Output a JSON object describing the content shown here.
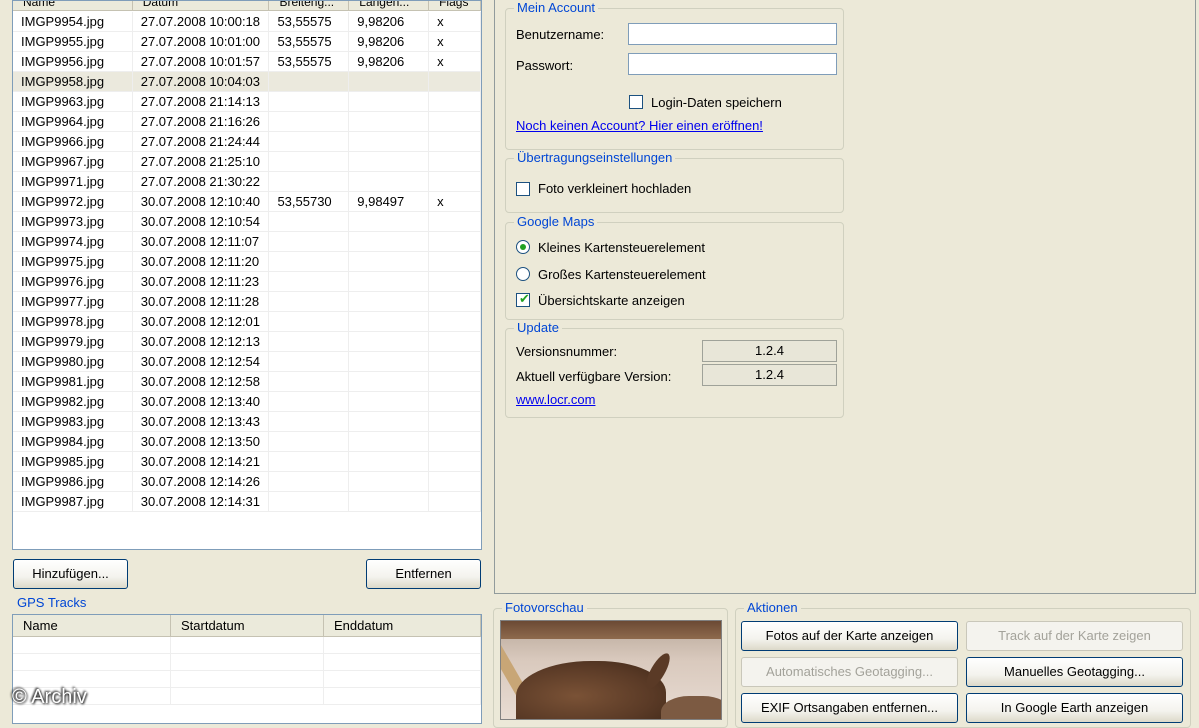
{
  "photo_list": {
    "columns": [
      "Name",
      "Datum",
      "Breiteng...",
      "Längen...",
      "Flags"
    ],
    "rows": [
      [
        "IMGP9954.jpg",
        "27.07.2008 10:00:18",
        "53,55575",
        "9,98206",
        "x"
      ],
      [
        "IMGP9955.jpg",
        "27.07.2008 10:01:00",
        "53,55575",
        "9,98206",
        "x"
      ],
      [
        "IMGP9956.jpg",
        "27.07.2008 10:01:57",
        "53,55575",
        "9,98206",
        "x"
      ],
      [
        "IMGP9958.jpg",
        "27.07.2008 10:04:03",
        "",
        "",
        ""
      ],
      [
        "IMGP9963.jpg",
        "27.07.2008 21:14:13",
        "",
        "",
        ""
      ],
      [
        "IMGP9964.jpg",
        "27.07.2008 21:16:26",
        "",
        "",
        ""
      ],
      [
        "IMGP9966.jpg",
        "27.07.2008 21:24:44",
        "",
        "",
        ""
      ],
      [
        "IMGP9967.jpg",
        "27.07.2008 21:25:10",
        "",
        "",
        ""
      ],
      [
        "IMGP9971.jpg",
        "27.07.2008 21:30:22",
        "",
        "",
        ""
      ],
      [
        "IMGP9972.jpg",
        "30.07.2008 12:10:40",
        "53,55730",
        "9,98497",
        "x"
      ],
      [
        "IMGP9973.jpg",
        "30.07.2008 12:10:54",
        "",
        "",
        ""
      ],
      [
        "IMGP9974.jpg",
        "30.07.2008 12:11:07",
        "",
        "",
        ""
      ],
      [
        "IMGP9975.jpg",
        "30.07.2008 12:11:20",
        "",
        "",
        ""
      ],
      [
        "IMGP9976.jpg",
        "30.07.2008 12:11:23",
        "",
        "",
        ""
      ],
      [
        "IMGP9977.jpg",
        "30.07.2008 12:11:28",
        "",
        "",
        ""
      ],
      [
        "IMGP9978.jpg",
        "30.07.2008 12:12:01",
        "",
        "",
        ""
      ],
      [
        "IMGP9979.jpg",
        "30.07.2008 12:12:13",
        "",
        "",
        ""
      ],
      [
        "IMGP9980.jpg",
        "30.07.2008 12:12:54",
        "",
        "",
        ""
      ],
      [
        "IMGP9981.jpg",
        "30.07.2008 12:12:58",
        "",
        "",
        ""
      ],
      [
        "IMGP9982.jpg",
        "30.07.2008 12:13:40",
        "",
        "",
        ""
      ],
      [
        "IMGP9983.jpg",
        "30.07.2008 12:13:43",
        "",
        "",
        ""
      ],
      [
        "IMGP9984.jpg",
        "30.07.2008 12:13:50",
        "",
        "",
        ""
      ],
      [
        "IMGP9985.jpg",
        "30.07.2008 12:14:21",
        "",
        "",
        ""
      ],
      [
        "IMGP9986.jpg",
        "30.07.2008 12:14:26",
        "",
        "",
        ""
      ],
      [
        "IMGP9987.jpg",
        "30.07.2008 12:14:31",
        "",
        "",
        ""
      ]
    ],
    "selected_row": 3,
    "add_button": "Hinzufügen...",
    "remove_button": "Entfernen"
  },
  "account": {
    "title": "Mein Account",
    "username_label": "Benutzername:",
    "username_value": "",
    "password_label": "Passwort:",
    "password_value": "",
    "save_login_label": "Login-Daten speichern",
    "save_login_checked": false,
    "signup_link": "Noch keinen Account? Hier einen eröffnen!"
  },
  "transfer": {
    "title": "Übertragungseinstellungen",
    "resize_label": "Foto verkleinert hochladen",
    "resize_checked": false
  },
  "google_maps": {
    "title": "Google Maps",
    "small_control_label": "Kleines Kartensteuerelement",
    "large_control_label": "Großes Kartensteuerelement",
    "selected": "small",
    "overview_label": "Übersichtskarte anzeigen",
    "overview_checked": true
  },
  "update": {
    "title": "Update",
    "version_label": "Versionsnummer:",
    "version_value": "1.2.4",
    "available_label": "Aktuell verfügbare Version:",
    "available_value": "1.2.4",
    "website_link": "www.locr.com"
  },
  "gps_tracks": {
    "title": "GPS Tracks",
    "columns": [
      "Name",
      "Startdatum",
      "Enddatum"
    ]
  },
  "preview": {
    "title": "Fotovorschau"
  },
  "actions": {
    "title": "Aktionen",
    "show_photos": "Fotos auf der Karte anzeigen",
    "show_track": "Track auf der Karte zeigen",
    "auto_geotag": "Automatisches Geotagging...",
    "manual_geotag": "Manuelles Geotagging...",
    "remove_exif": "EXIF Ortsangaben entfernen...",
    "google_earth": "In Google Earth anzeigen"
  },
  "watermark": "© Archiv",
  "colors": {
    "group_title": "#0046d5",
    "link": "#0000ee",
    "check_mark": "#21a121",
    "background": "#ece9d8"
  }
}
